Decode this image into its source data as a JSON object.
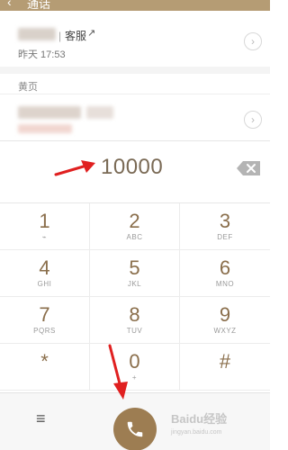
{
  "header": {
    "back_icon": "back-arrow-icon",
    "title": "通话"
  },
  "recent": {
    "separator": "|",
    "label": "客服",
    "link_icon": "↗",
    "time": "昨天 17:53",
    "chevron": "›"
  },
  "yellow_pages": {
    "section_title": "黄页",
    "chevron": "›"
  },
  "dialer": {
    "number": "10000",
    "backspace_icon": "backspace-icon"
  },
  "keypad": [
    {
      "digit": "1",
      "letters": "⌁"
    },
    {
      "digit": "2",
      "letters": "ABC"
    },
    {
      "digit": "3",
      "letters": "DEF"
    },
    {
      "digit": "4",
      "letters": "GHI"
    },
    {
      "digit": "5",
      "letters": "JKL"
    },
    {
      "digit": "6",
      "letters": "MNO"
    },
    {
      "digit": "7",
      "letters": "PQRS"
    },
    {
      "digit": "8",
      "letters": "TUV"
    },
    {
      "digit": "9",
      "letters": "WXYZ"
    },
    {
      "digit": "*",
      "letters": ""
    },
    {
      "digit": "0",
      "letters": "+"
    },
    {
      "digit": "#",
      "letters": ""
    }
  ],
  "bottom_bar": {
    "menu_icon": "≡",
    "call_icon": "phone-icon",
    "watermark": "Baidu经验",
    "watermark_sub": "jingyan.baidu.com"
  },
  "colors": {
    "header": "#b59c74",
    "digit": "#8a6e4b",
    "call_button": "#9d7d52",
    "annotation_arrow": "#e02020"
  }
}
